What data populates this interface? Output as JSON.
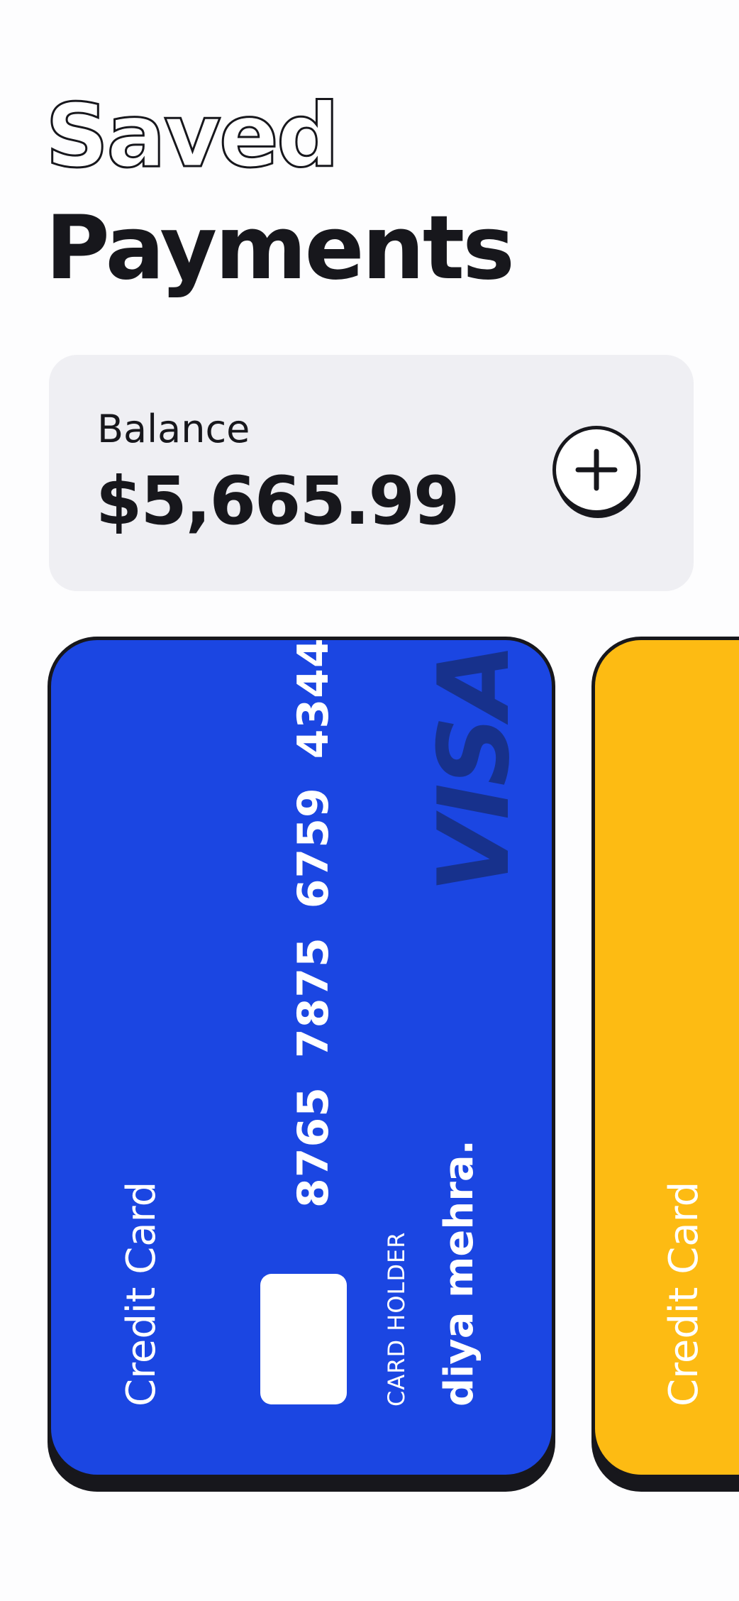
{
  "header": {
    "title_line1": "Saved",
    "title_line2": "Payments"
  },
  "balance": {
    "label": "Balance",
    "amount": "$5,665.99",
    "add_button_icon": "plus-icon"
  },
  "cards": [
    {
      "type_label": "Credit Card",
      "number": "8765 7875 6759 4344",
      "brand": "VISA",
      "holder_label": "CARD HOLDER",
      "holder_name": "diya mehra.",
      "color": "#1b46e2",
      "brand_color": "#17318c"
    },
    {
      "type_label": "Credit Card",
      "color": "#fdbb13"
    }
  ],
  "colors": {
    "background": "#fdfdfe",
    "text": "#17171c",
    "balance_card_bg": "#efeff3"
  }
}
